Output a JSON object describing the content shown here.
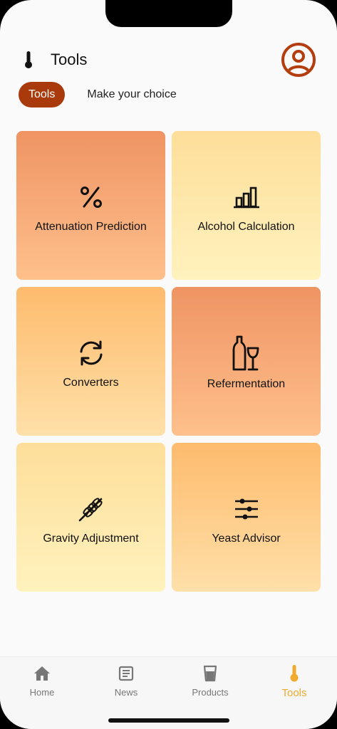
{
  "header": {
    "title": "Tools",
    "icon": "thermometer-icon",
    "profile_icon": "user-avatar-icon",
    "accent_color": "#b33d0e"
  },
  "chips": {
    "active_label": "Tools",
    "subtitle": "Make your choice"
  },
  "tools": [
    {
      "label": "Attenuation Prediction",
      "icon": "percent-icon"
    },
    {
      "label": "Alcohol Calculation",
      "icon": "bar-chart-icon"
    },
    {
      "label": "Converters",
      "icon": "refresh-icon"
    },
    {
      "label": "Refermentation",
      "icon": "bottle-glass-icon"
    },
    {
      "label": "Gravity Adjustment",
      "icon": "wheat-icon"
    },
    {
      "label": "Yeast Advisor",
      "icon": "sliders-icon"
    }
  ],
  "nav": {
    "items": [
      {
        "label": "Home",
        "icon": "home-icon"
      },
      {
        "label": "News",
        "icon": "news-icon"
      },
      {
        "label": "Products",
        "icon": "glass-icon"
      },
      {
        "label": "Tools",
        "icon": "thermometer-icon"
      }
    ],
    "active_color": "#f0aa2e",
    "inactive_color": "#777777"
  }
}
